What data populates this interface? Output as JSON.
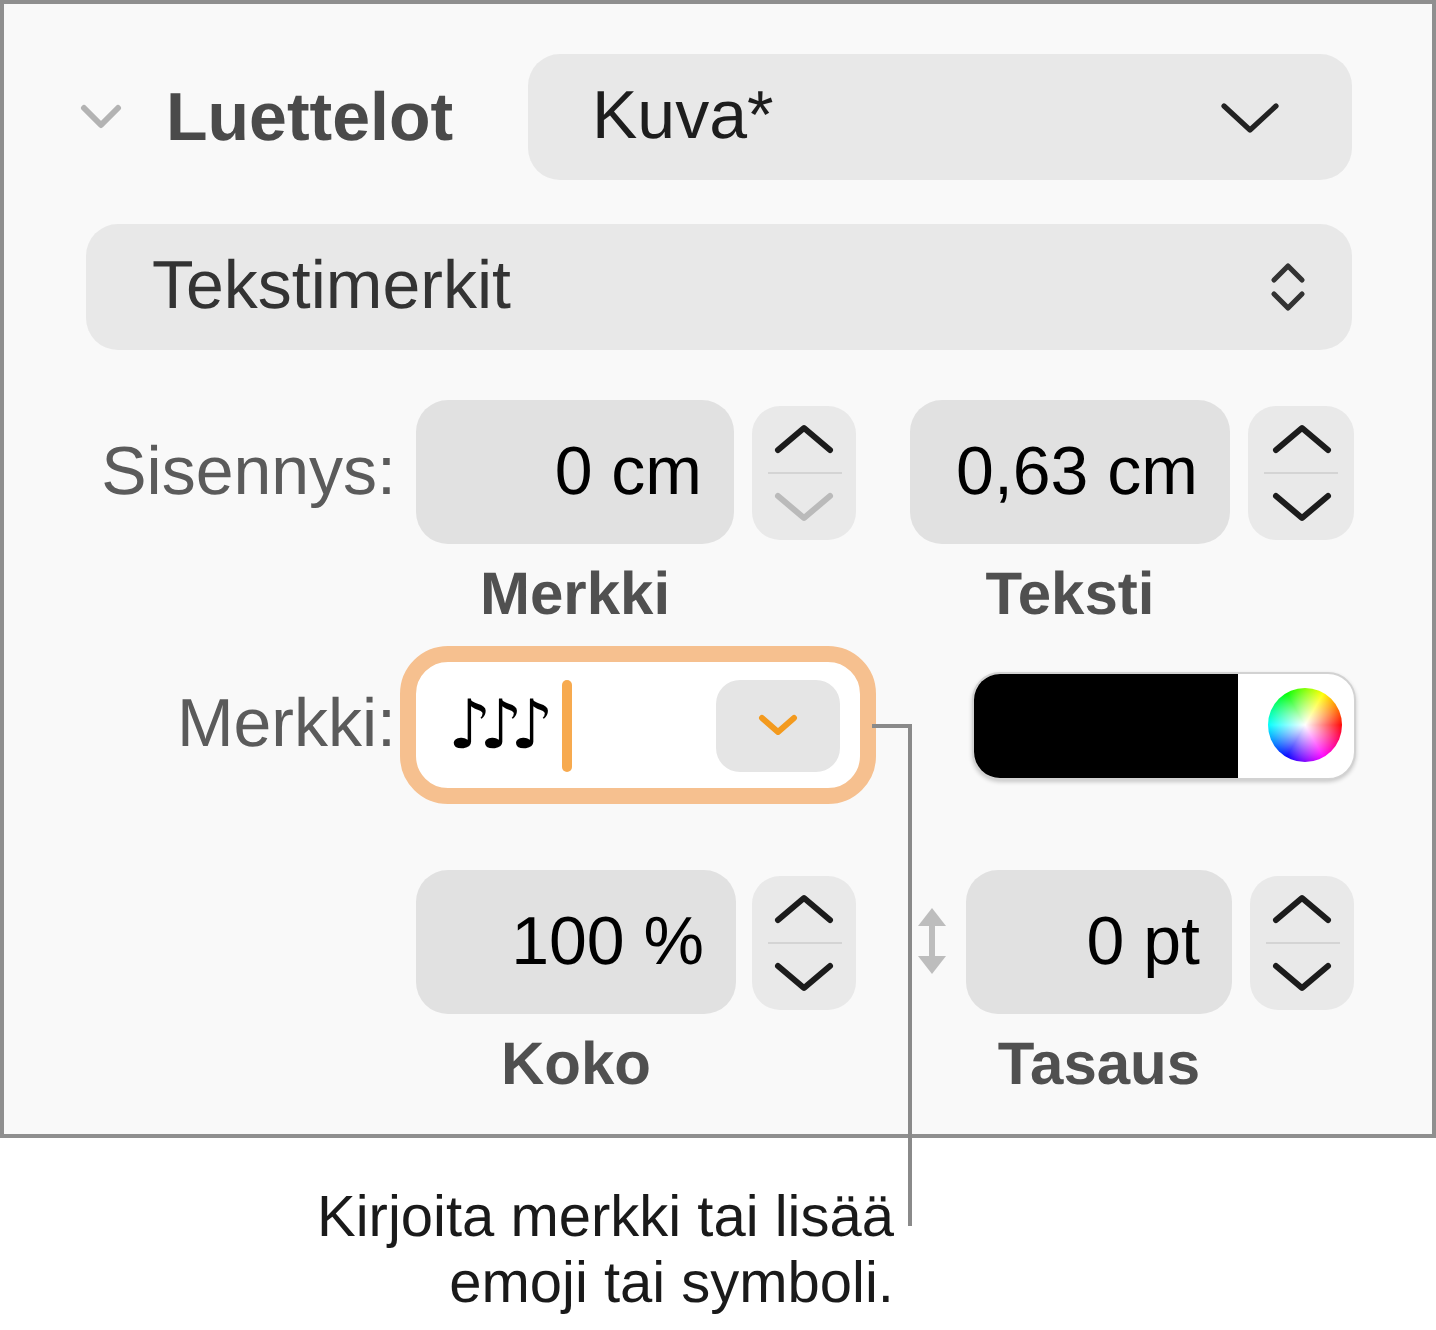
{
  "section": {
    "title": "Luettelot",
    "expanded": true
  },
  "list_style": {
    "value": "Kuva*"
  },
  "bullet_type": {
    "value": "Tekstimerkit"
  },
  "indent": {
    "label": "Sisennys:",
    "fields": [
      {
        "value": "0 cm",
        "caption": "Merkki",
        "increment_disabled": false,
        "decrement_disabled": true
      },
      {
        "value": "0,63 cm",
        "caption": "Teksti",
        "increment_disabled": false,
        "decrement_disabled": false
      }
    ]
  },
  "bullet": {
    "label": "Merkki:",
    "value": "♪♪♪",
    "focused": true,
    "color": "#000000"
  },
  "size_alignment": {
    "fields": [
      {
        "kind": "size",
        "value": "100 %",
        "caption": "Koko",
        "increment_disabled": false,
        "decrement_disabled": false
      },
      {
        "kind": "alignment",
        "value": "0 pt",
        "caption": "Tasaus",
        "increment_disabled": false,
        "decrement_disabled": false
      }
    ]
  },
  "callout": {
    "text": "Kirjoita merkki tai lisää emoji tai symboli."
  }
}
